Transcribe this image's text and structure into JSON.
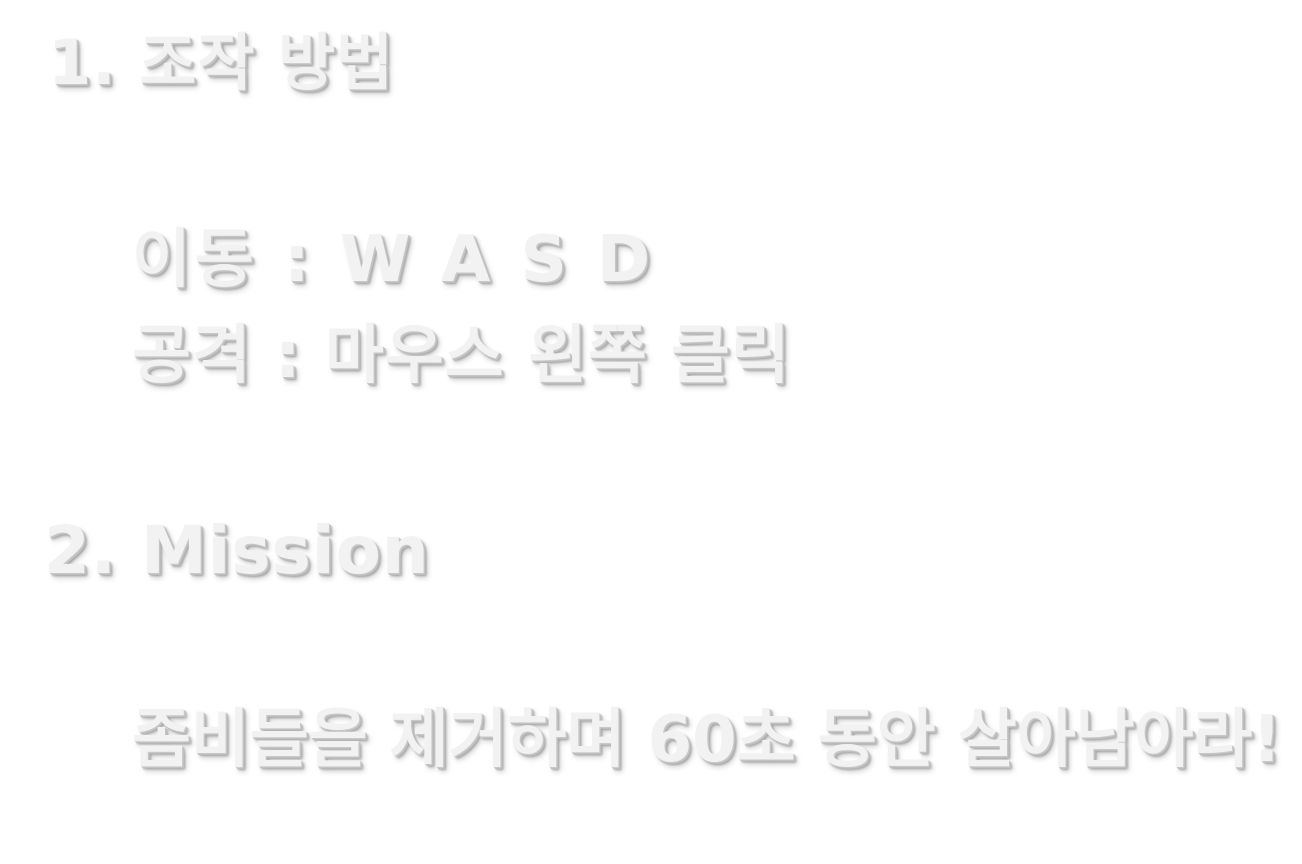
{
  "instructions": {
    "controls_heading": "1. 조작 방법",
    "move_line": "이동 : W A S D",
    "attack_line": "공격 : 마우스 왼쪽 클릭",
    "mission_heading": "2. Mission",
    "mission_line": "좀비들을 제거하며 60초 동안 살아남아라!"
  },
  "colors": {
    "background": "#ffffff",
    "text_fill": "#f2f2f2",
    "text_shadow": "#bdbdbd"
  }
}
